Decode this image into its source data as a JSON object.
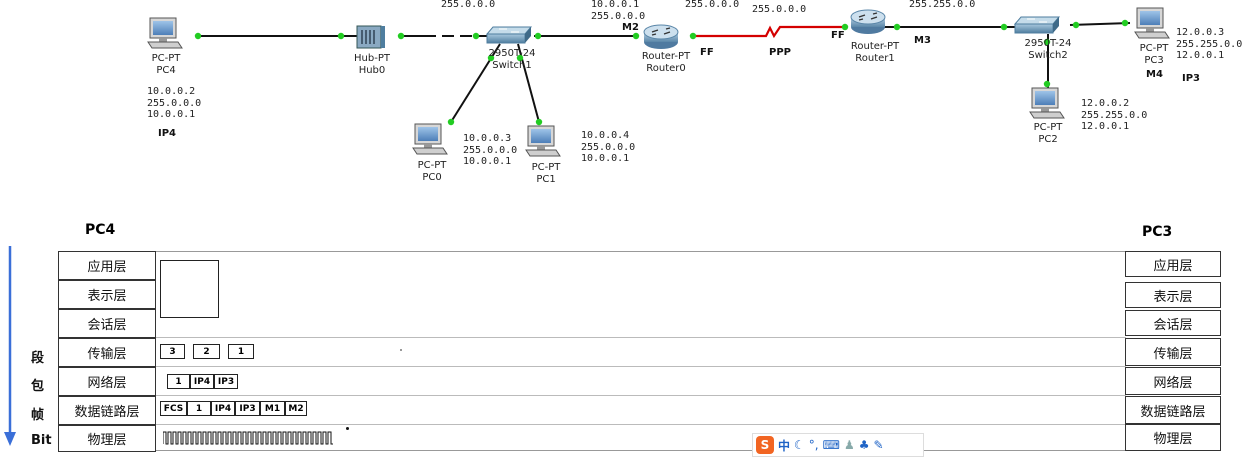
{
  "devices": {
    "pc4": {
      "type": "PC-PT",
      "name": "PC4",
      "ip": "10.0.0.2",
      "mask": "255.0.0.0",
      "gw": "10.0.0.1",
      "tag": "IP4"
    },
    "hub0": {
      "type": "Hub-PT",
      "name": "Hub0"
    },
    "switch1": {
      "type": "2950T-24",
      "name": "Switch1",
      "mask_top": "255.0.0.0"
    },
    "pc0": {
      "type": "PC-PT",
      "name": "PC0",
      "ip": "10.0.0.3",
      "mask": "255.0.0.0",
      "gw": "10.0.0.1"
    },
    "pc1": {
      "type": "PC-PT",
      "name": "PC1",
      "ip": "10.0.0.4",
      "mask": "255.0.0.0",
      "gw": "10.0.0.1"
    },
    "router0": {
      "type": "Router-PT",
      "name": "Router0",
      "ip": "10.0.0.1",
      "mask": "255.0.0.0",
      "tag": "M2",
      "right_mask": "255.0.0.0",
      "ff": "FF"
    },
    "ppp": {
      "label": "PPP",
      "mask": "255.0.0.0"
    },
    "router1": {
      "type": "Router-PT",
      "name": "Router1",
      "ff": "FF",
      "tag": "M3",
      "mask": "255.255.0.0"
    },
    "switch2": {
      "type": "2950T-24",
      "name": "Switch2"
    },
    "pc3": {
      "type": "PC-PT",
      "name": "PC3",
      "ip": "12.0.0.3",
      "mask": "255.255.0.0",
      "gw": "12.0.0.1",
      "tag": "M4",
      "tag2": "IP3"
    },
    "pc2": {
      "type": "PC-PT",
      "name": "PC2",
      "ip": "12.0.0.2",
      "mask": "255.255.0.0",
      "gw": "12.0.0.1"
    }
  },
  "model": {
    "left_host": "PC4",
    "right_host": "PC3",
    "layers": [
      "应用层",
      "表示层",
      "会话层",
      "传输层",
      "网络层",
      "数据链路层",
      "物理层"
    ],
    "side_labels": [
      "段",
      "包",
      "帧",
      "Bit"
    ],
    "transport_segs": [
      "3",
      "2",
      "1"
    ],
    "network_segs": [
      "1",
      "IP4",
      "IP3"
    ],
    "link_segs": [
      "FCS",
      "1",
      "IP4",
      "IP3",
      "M1",
      "M2"
    ]
  },
  "ime": {
    "logo": "S",
    "lang": "中"
  },
  "colors": {
    "link": "#111111",
    "ppp": "#d40000",
    "port": "#22cc22",
    "arrow": "#3a6fd8"
  }
}
